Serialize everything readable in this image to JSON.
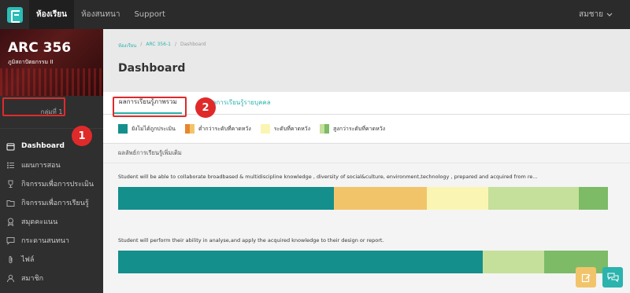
{
  "topnav": {
    "items": [
      "ห้องเรียน",
      "ห้องสนทนา",
      "Support"
    ],
    "user": "สมชาย"
  },
  "sidebar": {
    "course_code": "ARC 356",
    "course_name": "ภูมิสถาปัตยกรรม II",
    "group": "กลุ่มที่ 1",
    "items": [
      {
        "label": "Dashboard",
        "icon": "calendar-icon"
      },
      {
        "label": "แผนการสอน",
        "icon": "list-icon"
      },
      {
        "label": "กิจกรรมเพื่อการประเมิน",
        "icon": "trophy-icon"
      },
      {
        "label": "กิจกรรมเพื่อการเรียนรู้",
        "icon": "folder-icon"
      },
      {
        "label": "สมุดคะแนน",
        "icon": "award-icon"
      },
      {
        "label": "กระดานสนทนา",
        "icon": "chat-icon"
      },
      {
        "label": "ไฟล์",
        "icon": "paperclip-icon"
      },
      {
        "label": "สมาชิก",
        "icon": "user-icon"
      }
    ]
  },
  "breadcrumb": [
    "ห้องเรียน",
    "ARC 356-1",
    "Dashboard"
  ],
  "page_title": "Dashboard",
  "tabs": [
    "ผลการเรียนรู้ภาพรวม",
    "ผลการเรียนรู้รายบุคคล"
  ],
  "legend": [
    {
      "label": "ยังไม่ได้ถูกประเมิน",
      "colors": [
        "#148f8c"
      ]
    },
    {
      "label": "ต่ำกว่าระดับที่คาดหวัง",
      "colors": [
        "#e8872a",
        "#f2c46a"
      ]
    },
    {
      "label": "ระดับที่คาดหวัง",
      "colors": [
        "#fbf5b4"
      ]
    },
    {
      "label": "สูงกว่าระดับที่คาดหวัง",
      "colors": [
        "#c5e09a",
        "#7dbb67"
      ]
    }
  ],
  "section_title": "ผลลัพธ์การเรียนรู้เพิ่มเติม",
  "outcomes": [
    {
      "text": "Student will be able to collaborate broadbased & multidiscipline knowledge , diversity of social&culture, environment,technology , prepared and acquired from re...",
      "segments": [
        {
          "color": "#148f8c",
          "value": 44
        },
        {
          "color": "#f2c46a",
          "value": 19
        },
        {
          "color": "#fbf5b4",
          "value": 12.5
        },
        {
          "color": "#c5e09a",
          "value": 18.5
        },
        {
          "color": "#7dbb67",
          "value": 6
        }
      ]
    },
    {
      "text": "Student will perform their ability in analyse,and apply the acquired knowledge to their design or report.",
      "segments": [
        {
          "color": "#148f8c",
          "value": 74.5
        },
        {
          "color": "#c5e09a",
          "value": 12.5
        },
        {
          "color": "#7dbb67",
          "value": 13
        }
      ]
    }
  ],
  "annotations": [
    "1",
    "2"
  ],
  "fab_colors": {
    "edit": "#f2c46a",
    "chat": "#2bb3ad"
  }
}
